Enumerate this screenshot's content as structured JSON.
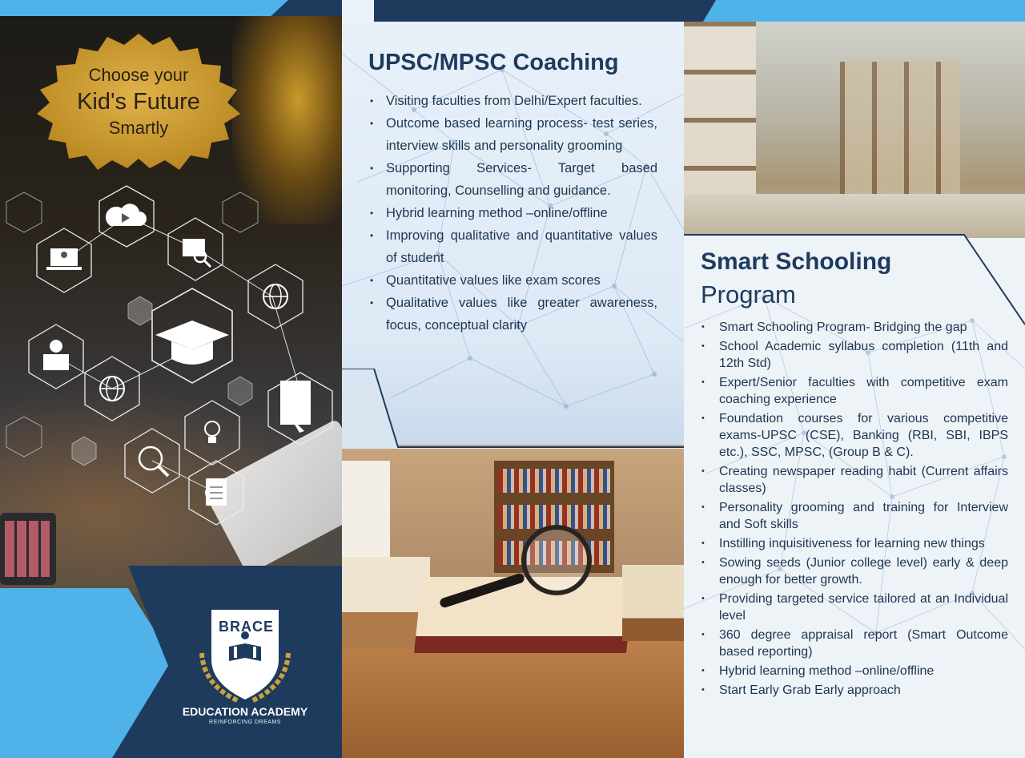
{
  "left_panel": {
    "badge": {
      "line1": "Choose your",
      "line2": "Kid's Future",
      "line3": "Smartly"
    },
    "brand": {
      "name": "BRACE",
      "academy": "EDUCATION ACADEMY",
      "tagline": "REINFORCING DREAMS"
    },
    "icons": [
      "cloud-video-icon",
      "laptop-user-icon",
      "browser-search-icon",
      "globe-cursor-icon",
      "graduation-cap-icon",
      "support-agent-icon",
      "globe-graduate-icon",
      "bulb-gear-icon",
      "magnifier-globe-icon",
      "document-icon",
      "book-hand-icon"
    ]
  },
  "middle_panel": {
    "title": "UPSC/MPSC Coaching",
    "items": [
      "Visiting faculties from Delhi/Expert faculties.",
      "Outcome based learning process- test series, interview skills and personality grooming",
      "Supporting Services- Target based monitoring, Counselling and guidance.",
      "Hybrid learning method –online/offline",
      "Improving qualitative and quantitative values of student",
      "Quantitative values like exam scores",
      "Qualitative values like greater awareness, focus, conceptual clarity"
    ]
  },
  "right_panel": {
    "title_line1": "Smart Schooling",
    "title_line2": "Program",
    "items": [
      "Smart Schooling Program- Bridging the gap",
      "School Academic syllabus completion (11th and 12th Std)",
      "Expert/Senior faculties with competitive exam coaching experience",
      "Foundation courses for various competitive exams-UPSC (CSE), Banking (RBI, SBI, IBPS etc.), SSC, MPSC, (Group B & C).",
      "Creating newspaper reading habit (Current affairs classes)",
      "Personality grooming and training for Interview and Soft skills",
      "Instilling inquisitiveness for learning new things",
      "Sowing seeds (Junior college level) early & deep enough for better growth.",
      "Providing targeted service tailored at an Individual level",
      "360 degree appraisal report (Smart Outcome based reporting)",
      "Hybrid learning method –online/offline",
      "Start Early Grab Early approach"
    ]
  },
  "colors": {
    "navy": "#1e3b5e",
    "sky_blue": "#4fb3ea",
    "gold": "#c99a2a",
    "text": "#1f3550"
  }
}
